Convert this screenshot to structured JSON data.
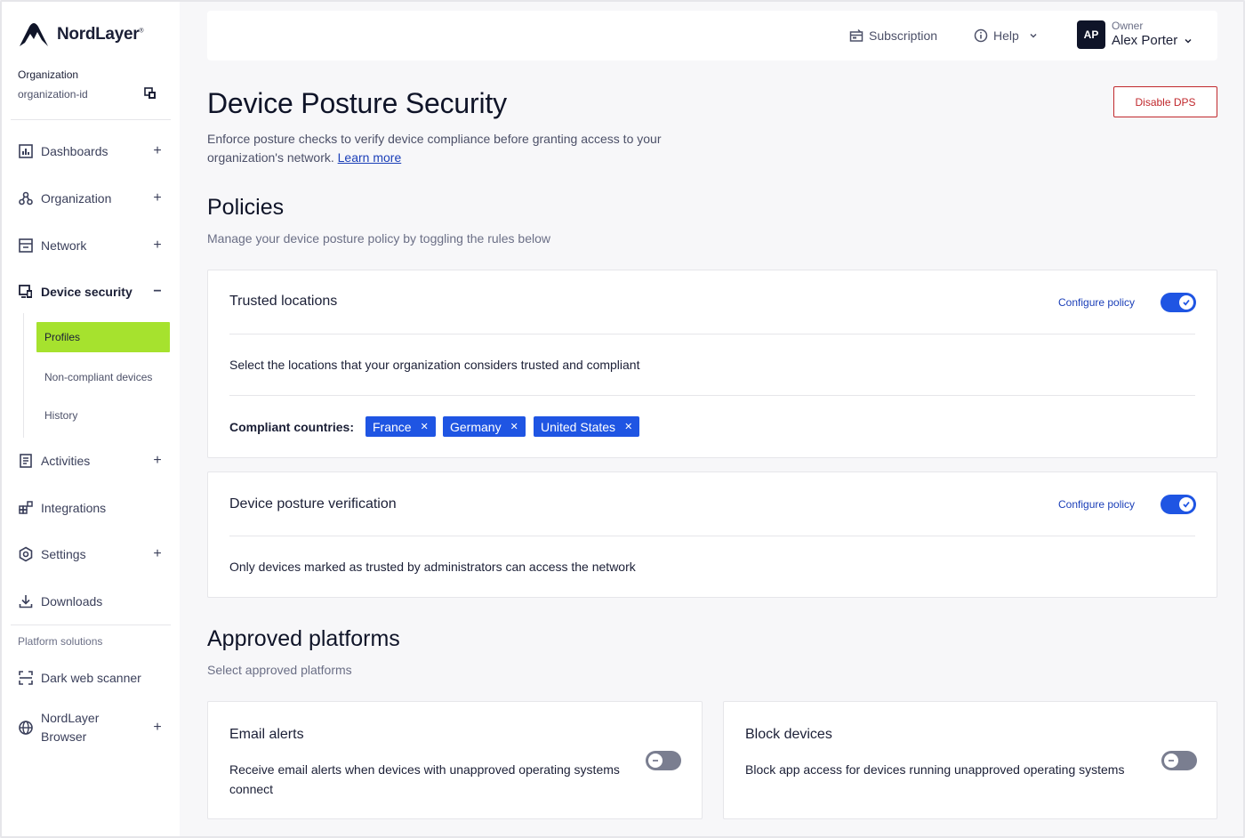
{
  "brand": {
    "name": "NordLayer",
    "mark": "®"
  },
  "organization": {
    "label": "Organization",
    "id": "organization-id"
  },
  "nav": {
    "dashboards": "Dashboards",
    "organization": "Organization",
    "network": "Network",
    "device_security": "Device security",
    "sub": {
      "profiles": "Profiles",
      "non_compliant": "Non-compliant devices",
      "history": "History"
    },
    "activities": "Activities",
    "integrations": "Integrations",
    "settings": "Settings",
    "downloads": "Downloads",
    "platform_solutions": "Platform solutions",
    "dark_web_scanner": "Dark web scanner",
    "nordlayer_browser_1": "NordLayer",
    "nordlayer_browser_2": "Browser"
  },
  "header": {
    "subscription": "Subscription",
    "help": "Help",
    "avatar_initials": "AP",
    "role": "Owner",
    "user_name": "Alex Porter"
  },
  "page": {
    "title": "Device Posture Security",
    "description": "Enforce posture checks to verify device compliance before granting access to your organization's network.",
    "learn_more": "Learn more",
    "disable_button": "Disable DPS"
  },
  "policies": {
    "title": "Policies",
    "subtitle": "Manage your device posture policy by toggling the rules below",
    "configure_label": "Configure policy",
    "trusted_locations": {
      "title": "Trusted locations",
      "description": "Select the locations that your organization considers trusted and compliant",
      "countries_label": "Compliant countries:",
      "countries": [
        "France",
        "Germany",
        "United States"
      ],
      "enabled": true
    },
    "device_posture": {
      "title": "Device posture verification",
      "description": "Only devices marked as trusted by administrators can access the network",
      "enabled": true
    }
  },
  "platforms": {
    "title": "Approved platforms",
    "subtitle": "Select approved platforms",
    "email_alerts": {
      "title": "Email alerts",
      "description": "Receive email alerts when devices with unapproved operating systems connect",
      "enabled": false
    },
    "block_devices": {
      "title": "Block devices",
      "description": "Block app access for devices running unapproved operating systems",
      "enabled": false
    }
  },
  "colors": {
    "accent": "#1f55e3",
    "active_nav": "#a6e22e",
    "danger": "#c0282d"
  }
}
